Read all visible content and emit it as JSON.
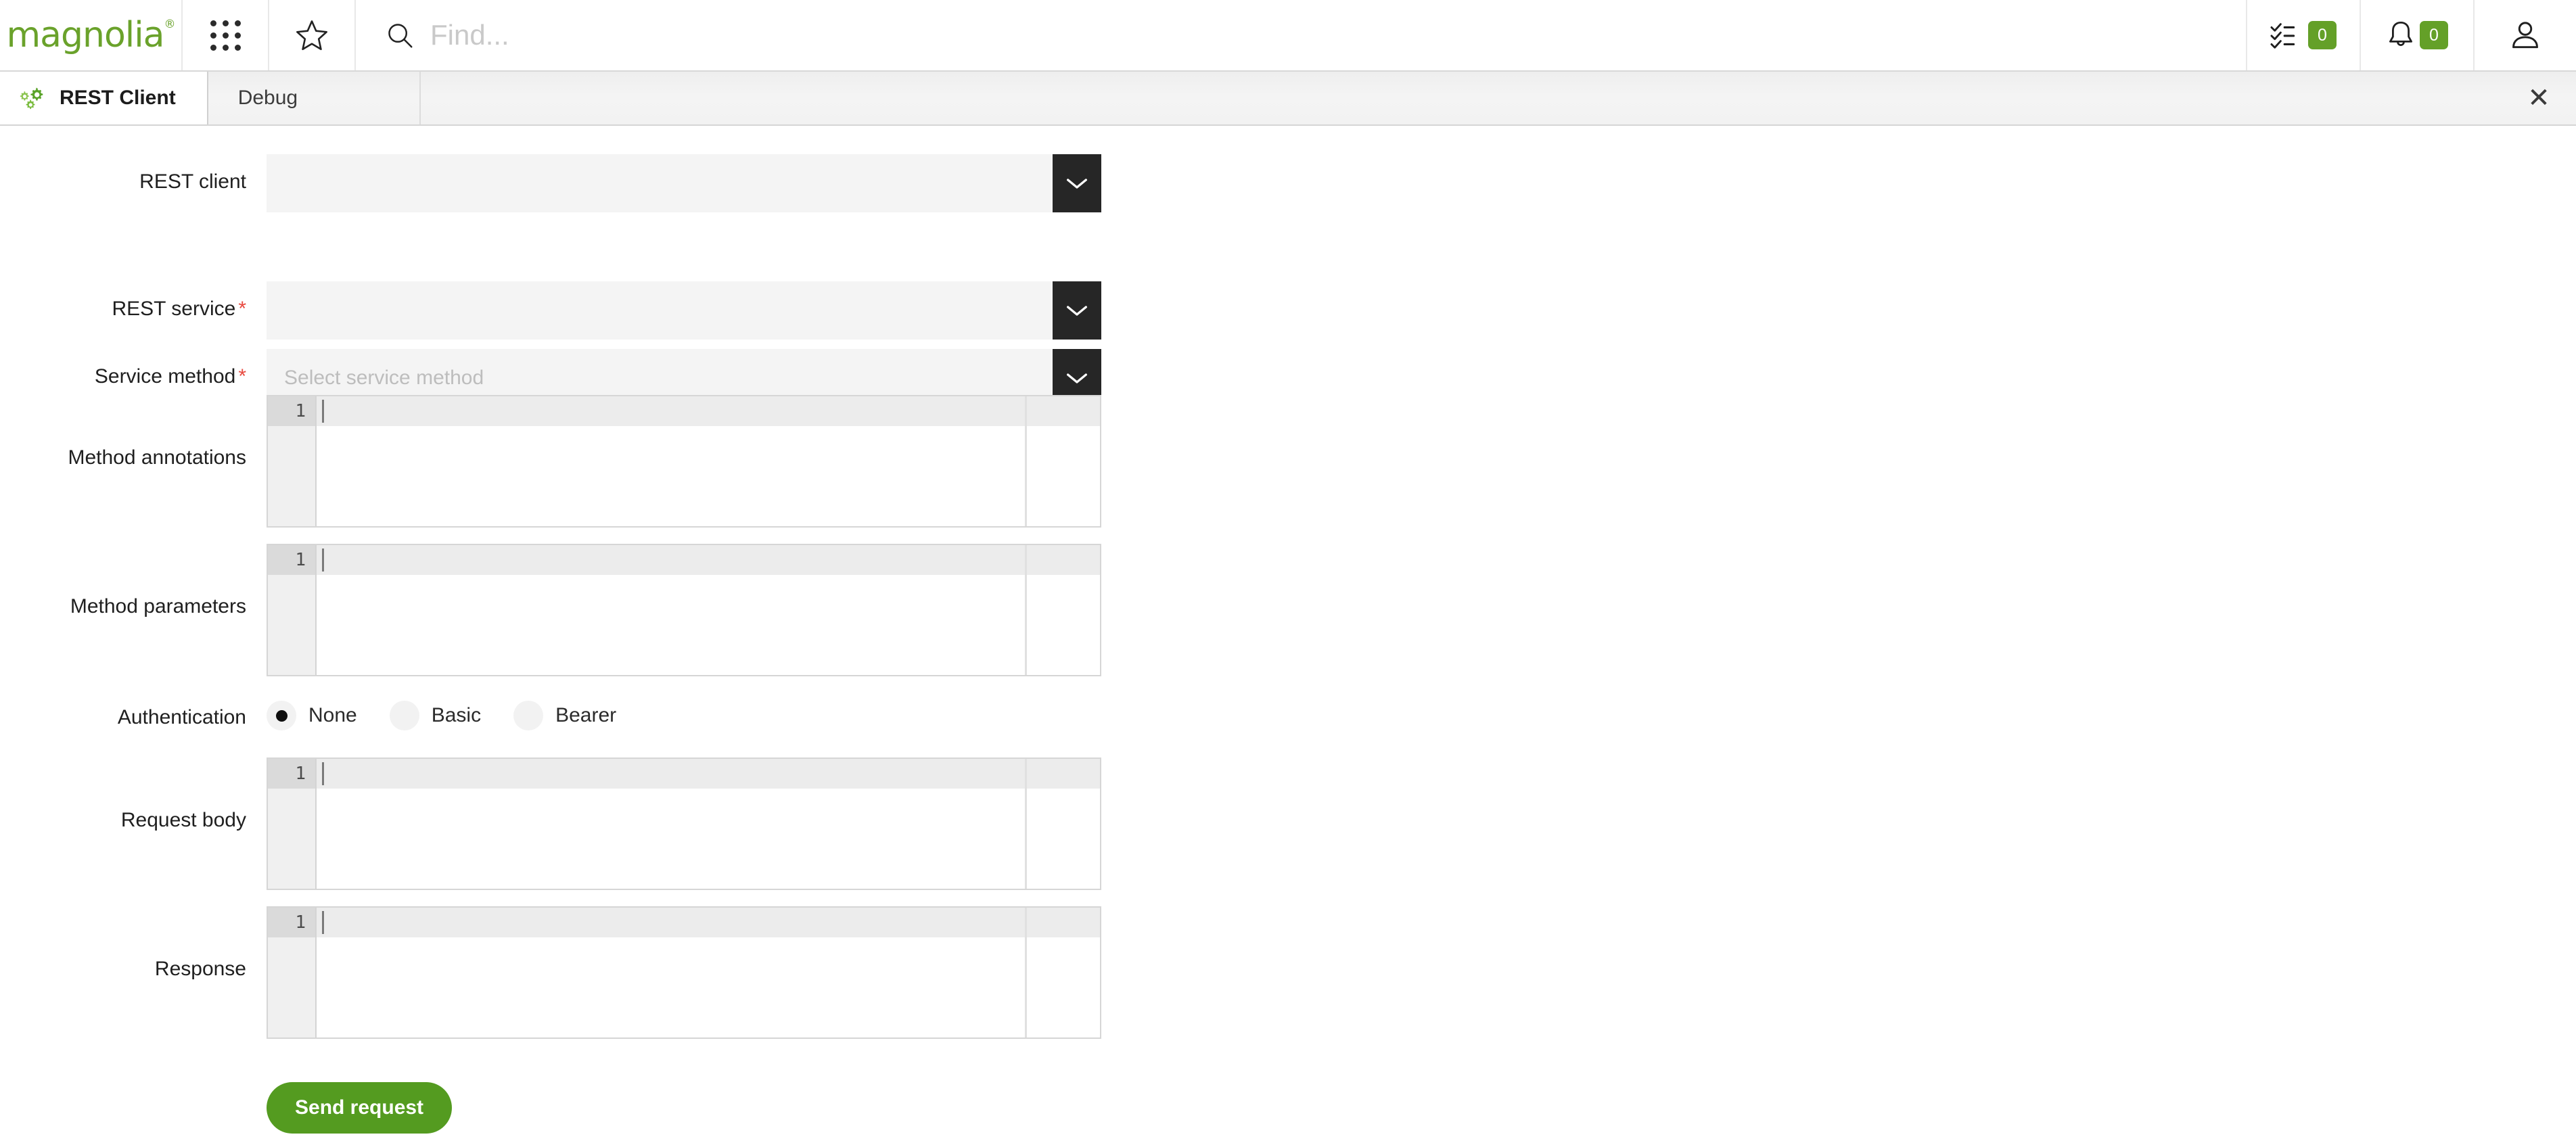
{
  "header": {
    "logo_text": "magnolia",
    "logo_superscript": "®",
    "logo_color": "#6aa22b",
    "apps_icon": "apps-grid-icon",
    "favorites_icon": "star-icon",
    "search": {
      "icon": "search-icon",
      "placeholder": "Find...",
      "value": ""
    },
    "tasks": {
      "icon": "tasks-checklist-icon",
      "count": "0"
    },
    "notifications": {
      "icon": "bell-icon",
      "count": "0"
    },
    "user": {
      "icon": "user-avatar-icon"
    },
    "badge_color": "#64a028"
  },
  "tabbar": {
    "tabs": [
      {
        "label": "REST Client",
        "icon": "gears-icon",
        "active": true
      },
      {
        "label": "Debug",
        "icon": "",
        "active": false
      }
    ],
    "close_label": "✕"
  },
  "form": {
    "fields": {
      "rest_client": {
        "label": "REST client",
        "required": false,
        "value": "",
        "placeholder": "",
        "chevron": "chevron-down-icon"
      },
      "rest_service": {
        "label": "REST service",
        "required": true,
        "required_mark": "*",
        "value": "",
        "placeholder": "",
        "chevron": "chevron-down-icon"
      },
      "service_method": {
        "label": "Service method",
        "required": true,
        "required_mark": "*",
        "value": "",
        "placeholder": "Select service method",
        "chevron": "chevron-down-icon"
      },
      "method_annotations": {
        "label": "Method annotations",
        "line_number": "1",
        "content": ""
      },
      "method_parameters": {
        "label": "Method parameters",
        "line_number": "1",
        "content": ""
      },
      "authentication": {
        "label": "Authentication",
        "options": [
          {
            "label": "None",
            "selected": true
          },
          {
            "label": "Basic",
            "selected": false
          },
          {
            "label": "Bearer",
            "selected": false
          }
        ]
      },
      "request_body": {
        "label": "Request body",
        "line_number": "1",
        "content": ""
      },
      "response": {
        "label": "Response",
        "line_number": "1",
        "content": ""
      }
    },
    "submit": {
      "label": "Send request",
      "color": "#549b20"
    }
  }
}
